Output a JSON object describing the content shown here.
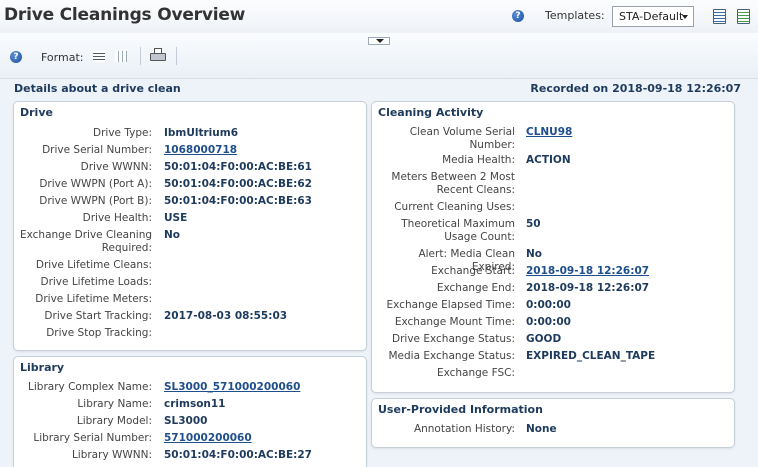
{
  "header": {
    "title": "Drive Cleanings Overview",
    "help_icon": "help-icon",
    "templates_label": "Templates:",
    "templates_value": "STA-Default"
  },
  "toolbar": {
    "format_label": "Format:",
    "icons": [
      "list-view-icon",
      "grid-view-icon",
      "print-icon"
    ]
  },
  "main": {
    "details_title": "Details about a drive clean",
    "recorded_label": "Recorded on 2018-09-18 12:26:07"
  },
  "drive": {
    "title": "Drive",
    "rows": [
      {
        "label": "Drive Type:",
        "value": "IbmUltrium6"
      },
      {
        "label": "Drive Serial Number:",
        "value": "1068000718"
      },
      {
        "label": "Drive WWNN:",
        "value": "50:01:04:F0:00:AC:BE:61"
      },
      {
        "label": "Drive WWPN (Port A):",
        "value": "50:01:04:F0:00:AC:BE:62"
      },
      {
        "label": "Drive WWPN (Port B):",
        "value": "50:01:04:F0:00:AC:BE:63"
      },
      {
        "label": "Drive Health:",
        "value": "USE"
      },
      {
        "label": "Exchange Drive Cleaning Required:",
        "value": "No"
      },
      {
        "label": "Drive Lifetime Cleans:",
        "value": ""
      },
      {
        "label": "Drive Lifetime Loads:",
        "value": ""
      },
      {
        "label": "Drive Lifetime Meters:",
        "value": ""
      },
      {
        "label": "Drive Start Tracking:",
        "value": "2017-08-03 08:55:03"
      },
      {
        "label": "Drive Stop Tracking:",
        "value": ""
      }
    ]
  },
  "library": {
    "title": "Library",
    "rows": [
      {
        "label": "Library Complex Name:",
        "value": "SL3000_571000200060"
      },
      {
        "label": "Library Name:",
        "value": "crimson11"
      },
      {
        "label": "Library Model:",
        "value": "SL3000"
      },
      {
        "label": "Library Serial Number:",
        "value": "571000200060"
      },
      {
        "label": "Library WWNN:",
        "value": "50:01:04:F0:00:AC:BE:27"
      }
    ]
  },
  "cleaning": {
    "title": "Cleaning Activity",
    "rows": [
      {
        "label": "Clean Volume Serial Number:",
        "value": "CLNU98"
      },
      {
        "label": "Media Health:",
        "value": "ACTION"
      },
      {
        "label": "Meters Between 2 Most Recent Cleans:",
        "value": ""
      },
      {
        "label": "Current Cleaning Uses:",
        "value": ""
      },
      {
        "label": "Theoretical Maximum Usage Count:",
        "value": "50"
      },
      {
        "label": "Alert: Media Clean Expired:",
        "value": "No"
      },
      {
        "label": "Exchange Start:",
        "value": "2018-09-18 12:26:07"
      },
      {
        "label": "Exchange End:",
        "value": "2018-09-18 12:26:07"
      },
      {
        "label": "Exchange Elapsed Time:",
        "value": "0:00:00"
      },
      {
        "label": "Exchange Mount Time:",
        "value": "0:00:00"
      },
      {
        "label": "Drive Exchange Status:",
        "value": "GOOD"
      },
      {
        "label": "Media Exchange Status:",
        "value": "EXPIRED_CLEAN_TAPE"
      },
      {
        "label": "Exchange FSC:",
        "value": ""
      }
    ]
  },
  "user_info": {
    "title": "User-Provided Information",
    "rows": [
      {
        "label": "Annotation History:",
        "value": "None"
      }
    ]
  }
}
